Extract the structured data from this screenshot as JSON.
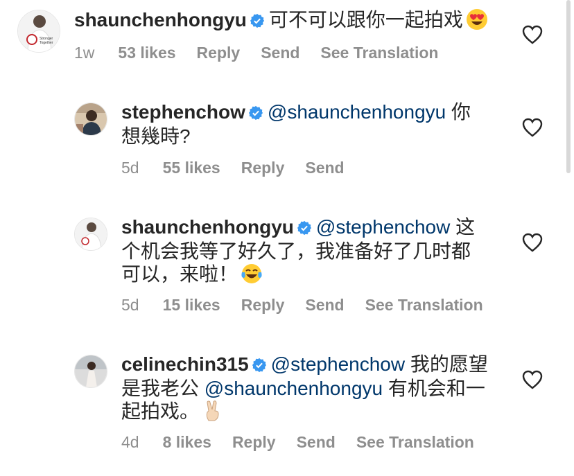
{
  "comments": [
    {
      "username": "shaunchenhongyu",
      "mention": "",
      "text": "可不可以跟你一起拍戏",
      "emoji": "heart-eyes",
      "time": "1w",
      "likes": "53 likes",
      "reply": "Reply",
      "send": "Send",
      "translate": "See Translation"
    },
    {
      "username": "stephenchow",
      "mention": "@shaunchenhongyu",
      "text_line1": "你",
      "text_line2": "想幾時?",
      "time": "5d",
      "likes": "55 likes",
      "reply": "Reply",
      "send": "Send"
    },
    {
      "username": "shaunchenhongyu",
      "mention": "@stephenchow",
      "text_line1": "这",
      "text_line2": "个机会我等了好久了，我准备好了几时都",
      "text_line3": "可以，来啦！",
      "emoji": "tears-of-joy",
      "time": "5d",
      "likes": "15 likes",
      "reply": "Reply",
      "send": "Send",
      "translate": "See Translation"
    },
    {
      "username": "celinechin315",
      "mention": "@stephenchow",
      "text_line1": "我的愿望",
      "text_line2a": "是我老公",
      "mention2": "@shaunchenhongyu",
      "text_line2b": "有机会和一",
      "text_line3": "起拍戏。",
      "emoji": "victory-hand",
      "time": "4d",
      "likes": "8 likes",
      "reply": "Reply",
      "send": "Send",
      "translate": "See Translation"
    }
  ],
  "avatar_texts": {
    "stronger": "Stronger",
    "together": "Together"
  },
  "colors": {
    "verified": "#3897f0",
    "mention": "#00376b",
    "meta": "#8e8e8e",
    "text": "#262626"
  }
}
